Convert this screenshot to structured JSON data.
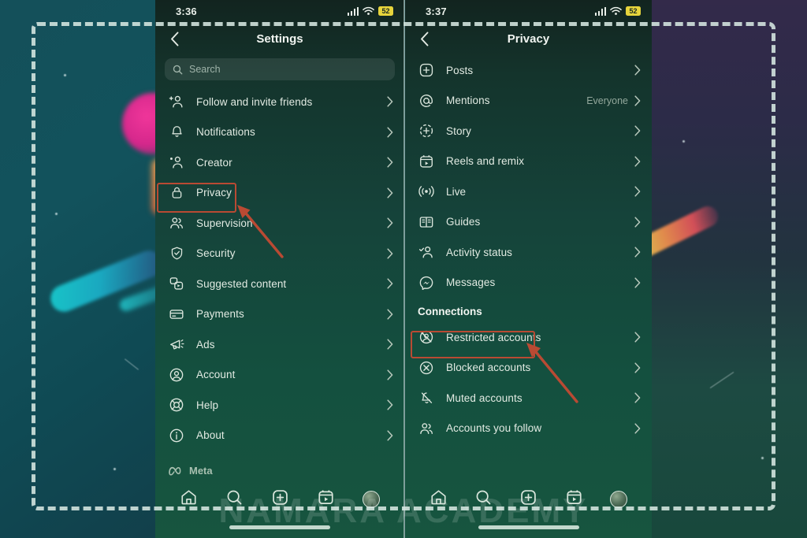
{
  "selection": {
    "label": "screenshot-selection-frame"
  },
  "watermark": {
    "text": "NAMARA ACADEMY"
  },
  "left_phone": {
    "status_bar": {
      "clock": "3:36",
      "battery_level": "52",
      "wifi": "wifi-icon",
      "signal": "signal-icon"
    },
    "header": {
      "title": "Settings",
      "back": "back-chevron-icon"
    },
    "search": {
      "placeholder": "Search",
      "value": ""
    },
    "items": [
      {
        "icon": "follow-invite-friends-icon",
        "label": "Follow and invite friends",
        "value": "",
        "chevron": "›"
      },
      {
        "icon": "bell-icon",
        "label": "Notifications",
        "value": "",
        "chevron": "›"
      },
      {
        "icon": "creator-icon",
        "label": "Creator",
        "value": "",
        "chevron": "›"
      },
      {
        "icon": "lock-icon",
        "label": "Privacy",
        "value": "",
        "chevron": "›"
      },
      {
        "icon": "supervision-icon",
        "label": "Supervision",
        "value": "",
        "chevron": "›"
      },
      {
        "icon": "shield-check-icon",
        "label": "Security",
        "value": "",
        "chevron": "›"
      },
      {
        "icon": "suggested-content-icon",
        "label": "Suggested content",
        "value": "",
        "chevron": "›"
      },
      {
        "icon": "credit-card-icon",
        "label": "Payments",
        "value": "",
        "chevron": "›"
      },
      {
        "icon": "megaphone-icon",
        "label": "Ads",
        "value": "",
        "chevron": "›"
      },
      {
        "icon": "account-circle-icon",
        "label": "Account",
        "value": "",
        "chevron": "›"
      },
      {
        "icon": "lifebuoy-icon",
        "label": "Help",
        "value": "",
        "chevron": "›"
      },
      {
        "icon": "info-circle-icon",
        "label": "About",
        "value": "",
        "chevron": "›"
      }
    ],
    "footer": {
      "brand": "Meta",
      "brand_icon": "meta-infinity-icon"
    },
    "bottom_nav": [
      {
        "icon": "home-icon",
        "label": "Home"
      },
      {
        "icon": "search-icon",
        "label": "Search"
      },
      {
        "icon": "create-plus-icon",
        "label": "Create"
      },
      {
        "icon": "reels-icon",
        "label": "Reels"
      },
      {
        "icon": "profile-avatar-icon",
        "label": "Profile"
      }
    ],
    "highlight": {
      "target": "Privacy",
      "color": "#b94a33"
    }
  },
  "right_phone": {
    "status_bar": {
      "clock": "3:37",
      "battery_level": "52",
      "wifi": "wifi-icon",
      "signal": "signal-icon"
    },
    "header": {
      "title": "Privacy",
      "back": "back-chevron-icon"
    },
    "items": [
      {
        "icon": "posts-plus-icon",
        "label": "Posts",
        "value": "",
        "chevron": "›"
      },
      {
        "icon": "mentions-at-icon",
        "label": "Mentions",
        "value": "Everyone",
        "chevron": "›"
      },
      {
        "icon": "story-icon",
        "label": "Story",
        "value": "",
        "chevron": "›"
      },
      {
        "icon": "reels-remix-icon",
        "label": "Reels and remix",
        "value": "",
        "chevron": "›"
      },
      {
        "icon": "live-broadcast-icon",
        "label": "Live",
        "value": "",
        "chevron": "›"
      },
      {
        "icon": "guides-book-icon",
        "label": "Guides",
        "value": "",
        "chevron": "›"
      },
      {
        "icon": "activity-status-icon",
        "label": "Activity status",
        "value": "",
        "chevron": "›"
      },
      {
        "icon": "messenger-icon",
        "label": "Messages",
        "value": "",
        "chevron": "›"
      }
    ],
    "section_title": "Connections",
    "connection_items": [
      {
        "icon": "restricted-accounts-icon",
        "label": "Restricted accounts",
        "value": "",
        "chevron": "›"
      },
      {
        "icon": "blocked-accounts-icon",
        "label": "Blocked accounts",
        "value": "",
        "chevron": "›"
      },
      {
        "icon": "muted-accounts-icon",
        "label": "Muted accounts",
        "value": "",
        "chevron": "›"
      },
      {
        "icon": "accounts-you-follow-icon",
        "label": "Accounts you follow",
        "value": "",
        "chevron": "›"
      }
    ],
    "bottom_nav": [
      {
        "icon": "home-icon",
        "label": "Home"
      },
      {
        "icon": "search-icon",
        "label": "Search"
      },
      {
        "icon": "create-plus-icon",
        "label": "Create"
      },
      {
        "icon": "reels-icon",
        "label": "Reels"
      },
      {
        "icon": "profile-avatar-icon",
        "label": "Profile"
      }
    ],
    "highlight": {
      "target": "Restricted accounts",
      "color": "#b94a33"
    }
  }
}
